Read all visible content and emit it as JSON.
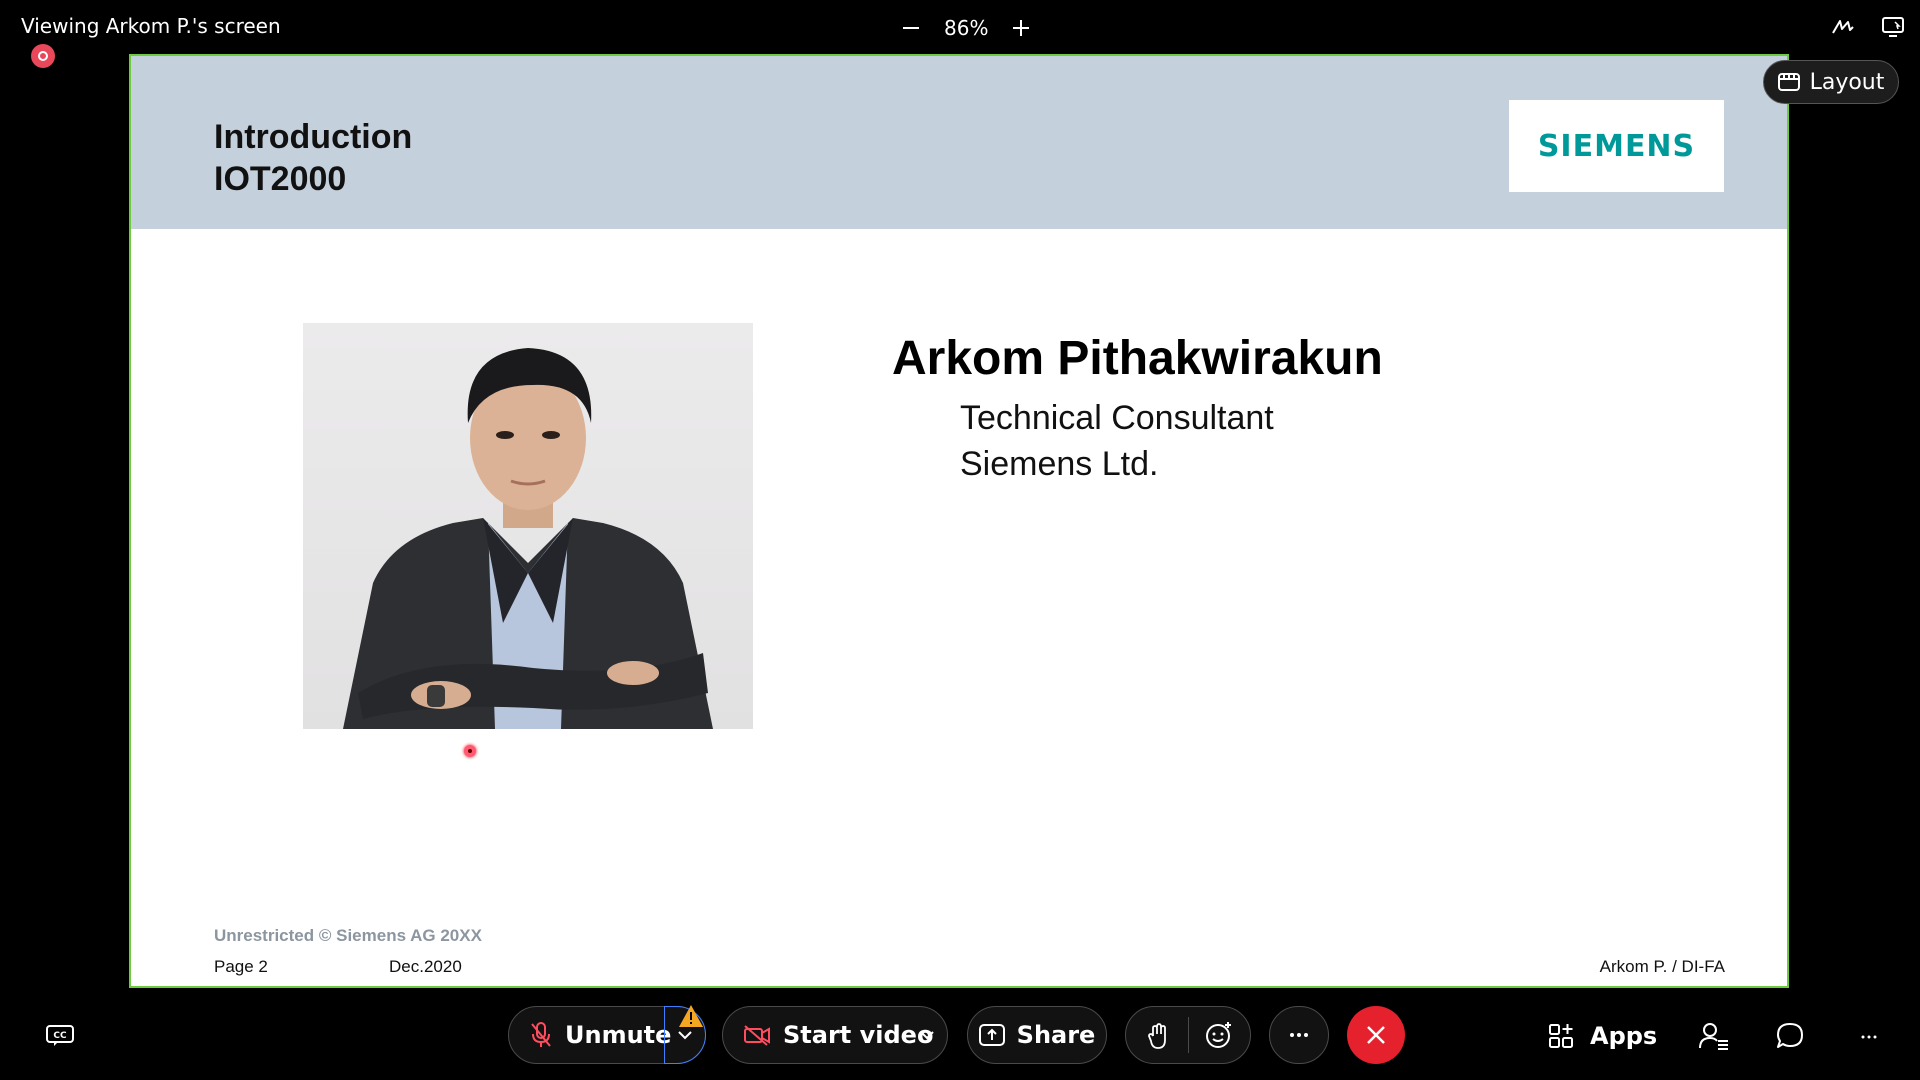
{
  "window": {
    "viewing_text": "Viewing Arkom P.'s screen",
    "zoom_level": "86%"
  },
  "layout_button": {
    "label": "Layout"
  },
  "slide": {
    "title_line1": "Introduction",
    "title_line2": "IOT2000",
    "logo_text": "SIEMENS",
    "name": "Arkom Pithakwirakun",
    "role": "Technical Consultant",
    "company": "Siemens Ltd.",
    "classification": "Unrestricted © Siemens AG 20XX",
    "page": "Page 2",
    "date": "Dec.2020",
    "author": "Arkom P. / DI-FA"
  },
  "toolbar": {
    "unmute_label": "Unmute",
    "start_video_label": "Start video",
    "share_label": "Share",
    "apps_label": "Apps"
  },
  "colors": {
    "accent_border": "#6ccb3f",
    "end_call": "#e4212d",
    "logo": "#009999",
    "header_band": "#c4d0dc"
  }
}
